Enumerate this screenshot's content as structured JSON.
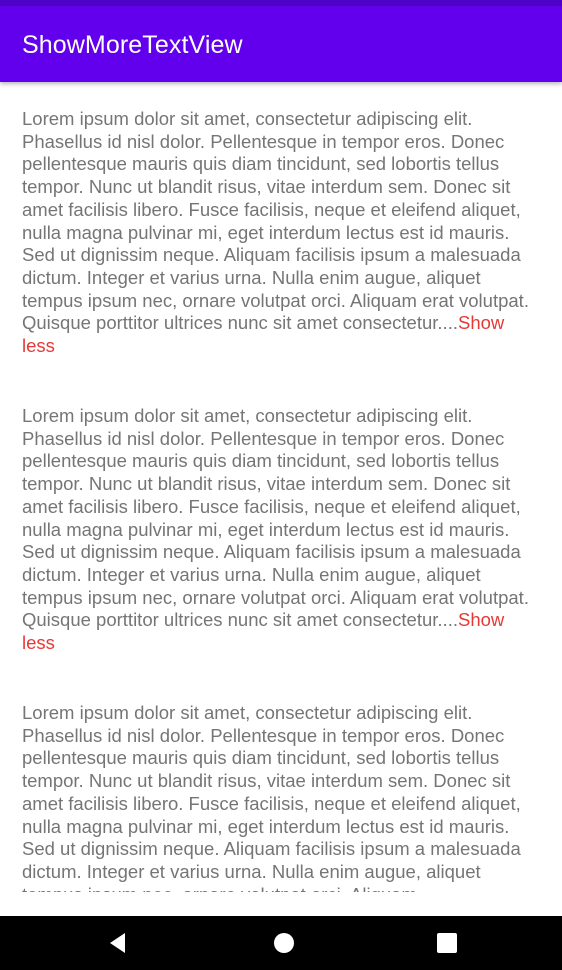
{
  "app_bar": {
    "title": "ShowMoreTextView",
    "color": "#6200ee",
    "status_bar_color": "#4e03c8"
  },
  "items": [
    {
      "text": "Lorem ipsum dolor sit amet, consectetur adipiscing elit. Phasellus id nisl dolor. Pellentesque in tempor eros. Donec pellentesque mauris quis diam tincidunt, sed lobortis tellus tempor. Nunc ut blandit risus, vitae interdum sem. Donec sit amet facilisis libero. Fusce facilisis, neque et eleifend aliquet, nulla magna pulvinar mi, eget interdum lectus est id mauris. Sed ut dignissim neque. Aliquam facilisis ipsum a malesuada dictum. Integer et varius urna. Nulla enim augue, aliquet tempus ipsum nec, ornare volutpat orci. Aliquam erat volutpat. Quisque porttitor ultrices nunc sit amet consectetur....",
      "toggle_label": "Show less"
    },
    {
      "text": "Lorem ipsum dolor sit amet, consectetur adipiscing elit. Phasellus id nisl dolor. Pellentesque in tempor eros. Donec pellentesque mauris quis diam tincidunt, sed lobortis tellus tempor. Nunc ut blandit risus, vitae interdum sem. Donec sit amet facilisis libero. Fusce facilisis, neque et eleifend aliquet, nulla magna pulvinar mi, eget interdum lectus est id mauris. Sed ut dignissim neque. Aliquam facilisis ipsum a malesuada dictum. Integer et varius urna. Nulla enim augue, aliquet tempus ipsum nec, ornare volutpat orci. Aliquam erat volutpat. Quisque porttitor ultrices nunc sit amet consectetur....",
      "toggle_label": "Show less"
    },
    {
      "text": "Lorem ipsum dolor sit amet, consectetur adipiscing elit. Phasellus id nisl dolor. Pellentesque in tempor eros. Donec pellentesque mauris quis diam tincidunt, sed lobortis tellus tempor. Nunc ut blandit risus, vitae interdum sem. Donec sit amet facilisis libero. Fusce facilisis, neque et eleifend aliquet, nulla magna pulvinar mi, eget interdum lectus est id mauris. Sed ut dignissim neque. Aliquam facilisis ipsum a malesuada dictum. Integer et varius urna. Nulla enim augue, aliquet tempus ipsum nec, ornare volutpat orci. Aliquam"
    }
  ],
  "colors": {
    "body_text": "#757575",
    "toggle_text": "#e53935"
  },
  "nav_bar": {
    "back_icon": "back-triangle-icon",
    "home_icon": "home-circle-icon",
    "recents_icon": "recents-square-icon"
  }
}
